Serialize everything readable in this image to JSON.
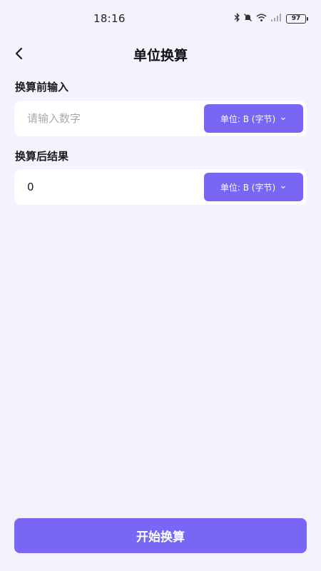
{
  "status_bar": {
    "time": "18:16",
    "battery": "97"
  },
  "header": {
    "title": "单位换算",
    "back_icon": "chevron-left-icon"
  },
  "input_section": {
    "label": "换算前输入",
    "placeholder": "请输入数字",
    "value": "",
    "unit_label": "单位: B (字节)"
  },
  "output_section": {
    "label": "换算后结果",
    "value": "0",
    "unit_label": "单位: B (字节)"
  },
  "action": {
    "button_label": "开始换算"
  },
  "colors": {
    "background": "#f4f2fd",
    "accent": "#7a66f5",
    "card": "#ffffff"
  }
}
